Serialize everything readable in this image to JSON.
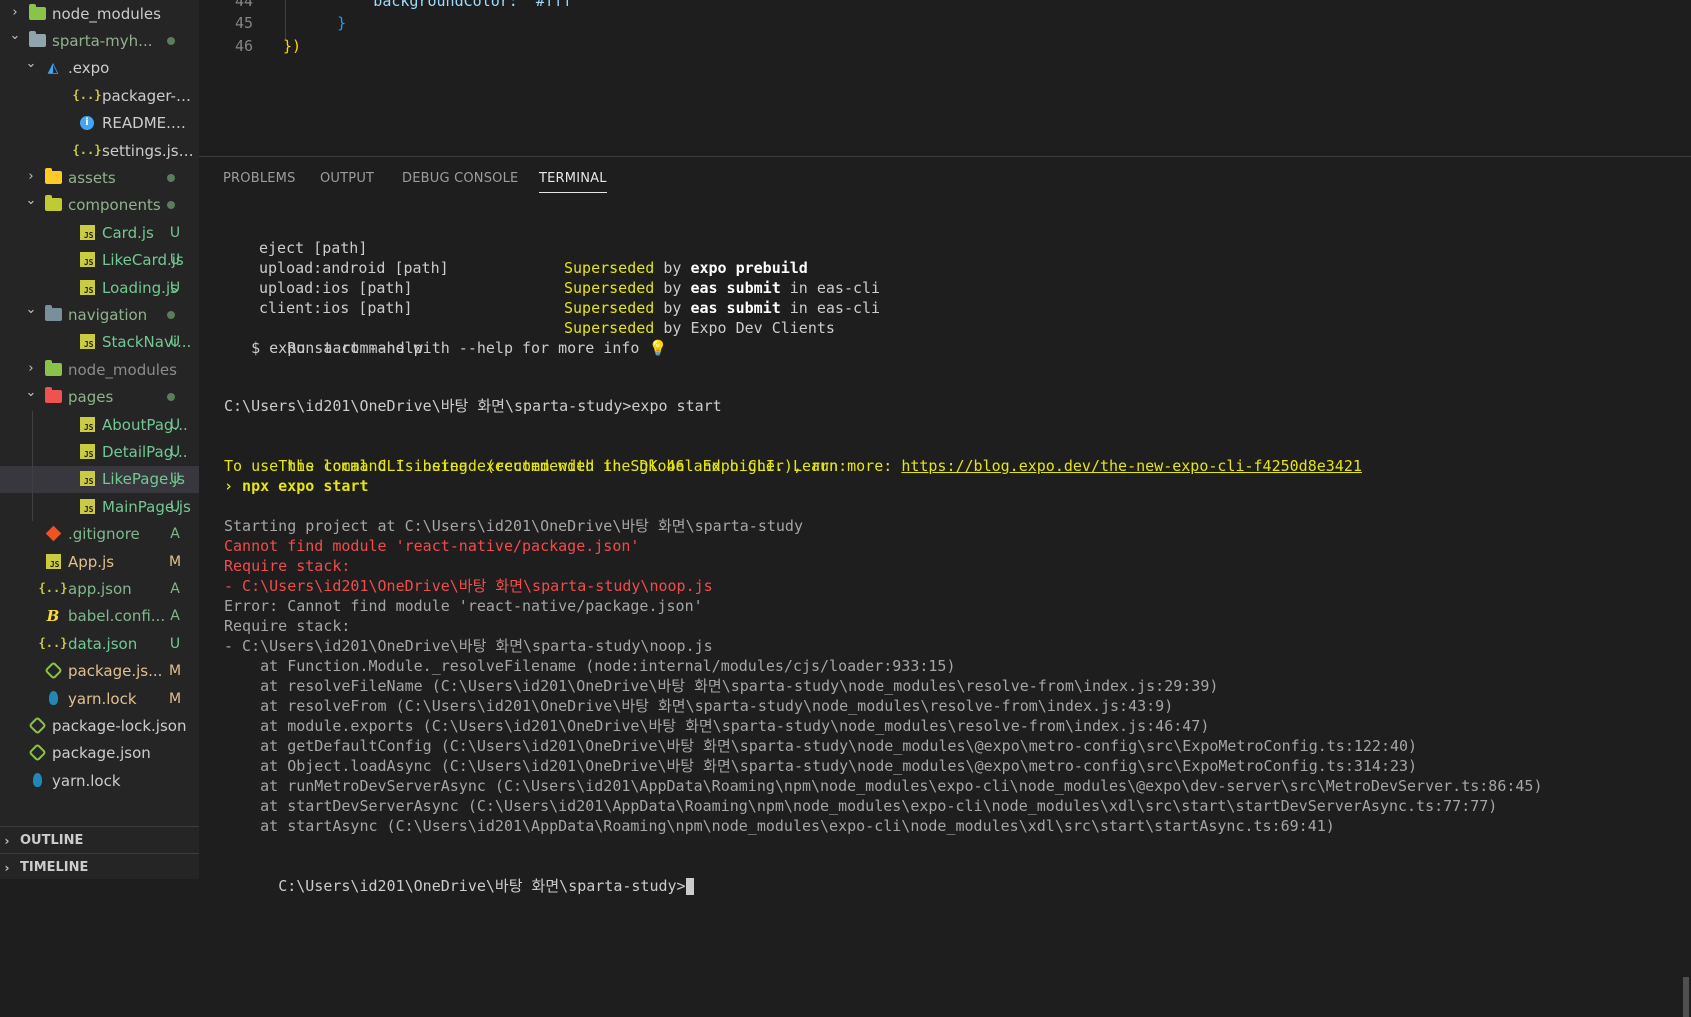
{
  "sidebar": {
    "items": [
      {
        "label": "node_modules",
        "level": 0,
        "expanded": false,
        "icon": "folder-node-icon",
        "badge": "",
        "dot": false
      },
      {
        "label": "sparta-myh...",
        "level": 0,
        "expanded": true,
        "icon": "folder-open-icon",
        "badge": "",
        "dot": true
      },
      {
        "label": ".expo",
        "level": 1,
        "expanded": true,
        "icon": "folder-expo-icon",
        "badge": "",
        "dot": false
      },
      {
        "label": "packager-info.j...",
        "level": 2,
        "icon": "json-icon",
        "badge": "",
        "dot": false
      },
      {
        "label": "README.md",
        "level": 2,
        "icon": "info-icon",
        "badge": "",
        "dot": false
      },
      {
        "label": "settings.json",
        "level": 2,
        "icon": "json-icon",
        "badge": "",
        "dot": false
      },
      {
        "label": "assets",
        "level": 1,
        "expanded": false,
        "icon": "folder-assets-icon",
        "badge": "",
        "dot": true
      },
      {
        "label": "components",
        "level": 1,
        "expanded": true,
        "icon": "folder-components-icon",
        "badge": "",
        "dot": true
      },
      {
        "label": "Card.js",
        "level": 2,
        "icon": "js-icon",
        "badge": "U",
        "dot": false
      },
      {
        "label": "LikeCard.js",
        "level": 2,
        "icon": "js-icon",
        "badge": "U",
        "dot": false
      },
      {
        "label": "Loading.js",
        "level": 2,
        "icon": "js-icon",
        "badge": "U",
        "dot": false
      },
      {
        "label": "navigation",
        "level": 1,
        "expanded": true,
        "icon": "folder-navigation-icon",
        "badge": "",
        "dot": true
      },
      {
        "label": "StackNavi...",
        "level": 2,
        "icon": "js-icon",
        "badge": "U",
        "dot": false
      },
      {
        "label": "node_modules",
        "level": 1,
        "expanded": false,
        "icon": "folder-node-icon",
        "badge": "",
        "dot": false
      },
      {
        "label": "pages",
        "level": 1,
        "expanded": true,
        "icon": "folder-pages-icon",
        "badge": "",
        "dot": true
      },
      {
        "label": "AboutPag...",
        "level": 2,
        "icon": "js-icon",
        "badge": "U",
        "dot": false
      },
      {
        "label": "DetailPag...",
        "level": 2,
        "icon": "js-icon",
        "badge": "U",
        "dot": false
      },
      {
        "label": "LikePage.js",
        "level": 2,
        "icon": "js-icon",
        "badge": "U",
        "dot": false,
        "selected": true
      },
      {
        "label": "MainPage.js",
        "level": 2,
        "icon": "js-icon",
        "badge": "U",
        "dot": false
      },
      {
        "label": ".gitignore",
        "level": 1,
        "icon": "git-icon",
        "badge": "A",
        "dot": false
      },
      {
        "label": "App.js",
        "level": 1,
        "icon": "js-icon",
        "badge": "M",
        "dot": false
      },
      {
        "label": "app.json",
        "level": 1,
        "icon": "json-icon",
        "badge": "A",
        "dot": false
      },
      {
        "label": "babel.confi...",
        "level": 1,
        "icon": "babel-icon",
        "badge": "A",
        "dot": false
      },
      {
        "label": "data.json",
        "level": 1,
        "icon": "json-icon",
        "badge": "U",
        "dot": false
      },
      {
        "label": "package.js...",
        "level": 1,
        "icon": "nodejs-icon",
        "badge": "M",
        "dot": false
      },
      {
        "label": "yarn.lock",
        "level": 1,
        "icon": "yarn-icon",
        "badge": "M",
        "dot": false
      },
      {
        "label": "package-lock.json",
        "level": 0,
        "icon": "nodejs-icon",
        "badge": "",
        "dot": false
      },
      {
        "label": "package.json",
        "level": 0,
        "icon": "nodejs-icon",
        "badge": "",
        "dot": false
      },
      {
        "label": "yarn.lock",
        "level": 0,
        "icon": "yarn-icon",
        "badge": "",
        "dot": false
      }
    ],
    "outline_label": "OUTLINE",
    "timeline_label": "TIMELINE"
  },
  "editor": {
    "lines": [
      {
        "num": "44",
        "code": "          backgroundColor: '#fff'"
      },
      {
        "num": "45",
        "code": "      }"
      },
      {
        "num": "46",
        "code": "})"
      }
    ]
  },
  "panel": {
    "tabs": [
      "PROBLEMS",
      "OUTPUT",
      "DEBUG CONSOLE",
      "TERMINAL"
    ],
    "active_tab": "TERMINAL"
  },
  "terminal": {
    "help_rows": [
      {
        "cmd": "eject [path]",
        "s1": "Superseded",
        "s2": " by ",
        "s3": "expo prebuild",
        "s4": ""
      },
      {
        "cmd": "upload:android [path]",
        "s1": "Superseded",
        "s2": " by ",
        "s3": "eas submit",
        "s4": " in eas-cli"
      },
      {
        "cmd": "upload:ios [path]",
        "s1": "Superseded",
        "s2": " by ",
        "s3": "eas submit",
        "s4": " in eas-cli"
      },
      {
        "cmd": "client:ios [path]",
        "s1": "Superseded",
        "s2": " by ",
        "s3": "",
        "s4": "Expo Dev Clients"
      }
    ],
    "help_hint": " Run a command with --help for more info ",
    "help_hint_emoji": "💡",
    "help_example": "   $ expo start --help",
    "prompt1": "C:\\Users\\id201\\OneDrive\\바탕 화면\\sparta-study>expo start",
    "warn1": "This command is being executed with the global Expo CLI. Learn more: ",
    "warn1_link": "https://blog.expo.dev/the-new-expo-cli-f4250d8e3421",
    "warn2": "To use the local CLI instead (recommended in SDK 46 and higher), run:",
    "warn3": "› npx expo start",
    "starting": "Starting project at C:\\Users\\id201\\OneDrive\\바탕 화면\\sparta-study",
    "err1": "Cannot find module 'react-native/package.json'",
    "err2": "Require stack:",
    "err3": "- C:\\Users\\id201\\OneDrive\\바탕 화면\\sparta-study\\noop.js",
    "stack": [
      "Error: Cannot find module 'react-native/package.json'",
      "Require stack:",
      "- C:\\Users\\id201\\OneDrive\\바탕 화면\\sparta-study\\noop.js",
      "    at Function.Module._resolveFilename (node:internal/modules/cjs/loader:933:15)",
      "    at resolveFileName (C:\\Users\\id201\\OneDrive\\바탕 화면\\sparta-study\\node_modules\\resolve-from\\index.js:29:39)",
      "    at resolveFrom (C:\\Users\\id201\\OneDrive\\바탕 화면\\sparta-study\\node_modules\\resolve-from\\index.js:43:9)",
      "    at module.exports (C:\\Users\\id201\\OneDrive\\바탕 화면\\sparta-study\\node_modules\\resolve-from\\index.js:46:47)",
      "    at getDefaultConfig (C:\\Users\\id201\\OneDrive\\바탕 화면\\sparta-study\\node_modules\\@expo\\metro-config\\src\\ExpoMetroConfig.ts:122:40)",
      "    at Object.loadAsync (C:\\Users\\id201\\OneDrive\\바탕 화면\\sparta-study\\node_modules\\@expo\\metro-config\\src\\ExpoMetroConfig.ts:314:23)",
      "    at runMetroDevServerAsync (C:\\Users\\id201\\AppData\\Roaming\\npm\\node_modules\\expo-cli\\node_modules\\@expo\\dev-server\\src\\MetroDevServer.ts:86:45)",
      "    at startDevServerAsync (C:\\Users\\id201\\AppData\\Roaming\\npm\\node_modules\\expo-cli\\node_modules\\xdl\\src\\start\\startDevServerAsync.ts:77:77)",
      "    at startAsync (C:\\Users\\id201\\AppData\\Roaming\\npm\\node_modules\\expo-cli\\node_modules\\xdl\\src\\start\\startAsync.ts:69:41)"
    ],
    "prompt2": "C:\\Users\\id201\\OneDrive\\바탕 화면\\sparta-study>"
  },
  "colors": {
    "badge_U": "#73c991",
    "badge_M": "#e2c08d",
    "badge_A": "#81b88b",
    "terminal_yellow": "#e5e510",
    "terminal_red": "#f14c4c"
  }
}
